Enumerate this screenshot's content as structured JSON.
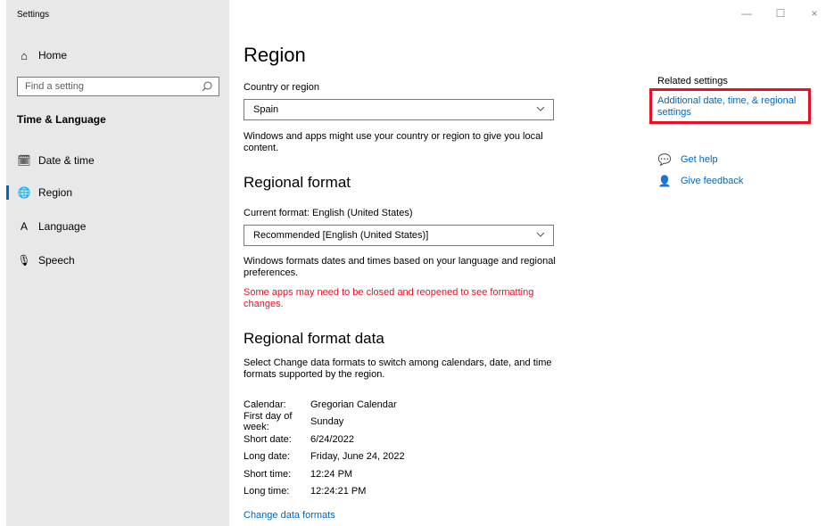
{
  "app": {
    "title": "Settings"
  },
  "window_controls": {
    "minimize": "—",
    "maximize": "☐",
    "close": "×"
  },
  "sidebar": {
    "home": {
      "icon": "home-icon",
      "label": "Home"
    },
    "search": {
      "placeholder": "Find a setting",
      "icon": "search-icon"
    },
    "section_label": "Time & Language",
    "items": [
      {
        "icon": "calendar-clock-icon",
        "label": "Date & time",
        "active": false
      },
      {
        "icon": "globe-icon",
        "label": "Region",
        "active": true
      },
      {
        "icon": "language-icon",
        "label": "Language",
        "active": false
      },
      {
        "icon": "microphone-icon",
        "label": "Speech",
        "active": false
      }
    ]
  },
  "main": {
    "title": "Region",
    "country": {
      "label": "Country or region",
      "selected": "Spain",
      "description": "Windows and apps might use your country or region to give you local content."
    },
    "regional_format": {
      "heading": "Regional format",
      "current_label": "Current format: English (United States)",
      "selected": "Recommended [English (United States)]",
      "description": "Windows formats dates and times based on your language and regional preferences.",
      "warning": "Some apps may need to be closed and reopened to see formatting changes."
    },
    "format_data": {
      "heading": "Regional format data",
      "description": "Select Change data formats to switch among calendars, date, and time formats supported by the region.",
      "rows": [
        {
          "key": "Calendar:",
          "value": "Gregorian Calendar"
        },
        {
          "key": "First day of week:",
          "value": "Sunday"
        },
        {
          "key": "Short date:",
          "value": "6/24/2022"
        },
        {
          "key": "Long date:",
          "value": "Friday, June 24, 2022"
        },
        {
          "key": "Short time:",
          "value": "12:24 PM"
        },
        {
          "key": "Long time:",
          "value": "12:24:21 PM"
        }
      ],
      "change_link": "Change data formats"
    }
  },
  "related": {
    "title": "Related settings",
    "link": "Additional date, time, & regional settings",
    "highlight_color": "#e81123",
    "help": {
      "icon": "chat-help-icon",
      "label": "Get help"
    },
    "feedback": {
      "icon": "feedback-person-icon",
      "label": "Give feedback"
    }
  },
  "colors": {
    "accent": "#0067c0",
    "warning": "#e81123",
    "sidebar_bg": "#e8e8e8"
  }
}
